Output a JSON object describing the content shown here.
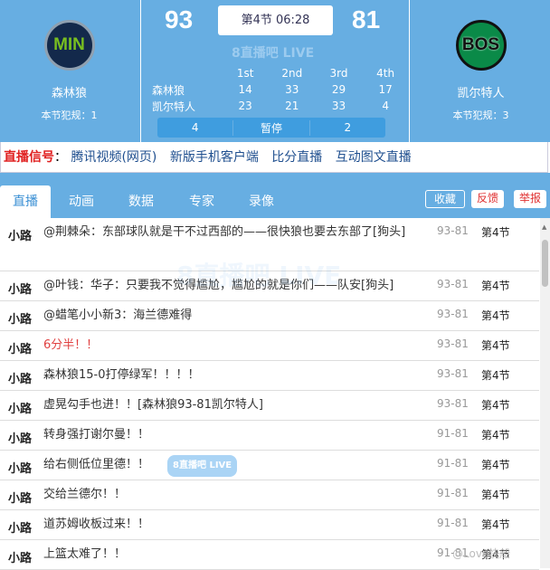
{
  "home": {
    "abbr": "MIN",
    "name": "森林狼",
    "fouls": "本节犯规：1",
    "score": "93",
    "timeouts": "4",
    "color": "#4bb53a"
  },
  "away": {
    "abbr": "BOS",
    "name": "凯尔特人",
    "fouls": "本节犯规：3",
    "score": "81",
    "timeouts": "2",
    "color": "#0a8a48"
  },
  "clock": "第4节 06:28",
  "watermark": "8直播吧 LIVE",
  "quarters": {
    "headers": [
      "1st",
      "2nd",
      "3rd",
      "4th"
    ],
    "rows": [
      {
        "team": "森林狼",
        "scores": [
          "14",
          "33",
          "29",
          "17"
        ]
      },
      {
        "team": "凯尔特人",
        "scores": [
          "23",
          "21",
          "33",
          "4"
        ]
      }
    ]
  },
  "timeout_label": "暂停",
  "signal": {
    "label": "直播信号",
    "colon": "：",
    "links": [
      "腾讯视频(网页)",
      "新版手机客户端",
      "比分直播",
      "互动图文直播"
    ]
  },
  "tabs": [
    "直播",
    "动画",
    "数据",
    "专家",
    "录像"
  ],
  "actions": [
    "收藏",
    "反馈",
    "举报"
  ],
  "feed": [
    {
      "who": "小路",
      "msg": "@荆棘朵：东部球队就是干不过西部的——很快狼也要去东部了[狗头]",
      "score": "93-81",
      "period": "第4节"
    },
    {
      "who": "小路",
      "msg": "@叶钱：华子：只要我不觉得尴尬，尴尬的就是你们——队安[狗头]",
      "score": "93-81",
      "period": "第4节"
    },
    {
      "who": "小路",
      "msg": "@蜡笔小小新3：海兰德难得",
      "score": "93-81",
      "period": "第4节"
    },
    {
      "who": "小路",
      "msg": "6分半！！",
      "score": "93-81",
      "period": "第4节"
    },
    {
      "who": "小路",
      "msg": "森林狼15-0打停绿军！！！！",
      "score": "93-81",
      "period": "第4节"
    },
    {
      "who": "小路",
      "msg": "虚晃勾手也进！！[森林狼93-81凯尔特人]",
      "score": "93-81",
      "period": "第4节"
    },
    {
      "who": "小路",
      "msg": "转身强打谢尔曼！！",
      "score": "91-81",
      "period": "第4节"
    },
    {
      "who": "小路",
      "msg": "给右侧低位里德！！",
      "score": "91-81",
      "period": "第4节"
    },
    {
      "who": "小路",
      "msg": "交给兰德尔！！",
      "score": "91-81",
      "period": "第4节"
    },
    {
      "who": "小路",
      "msg": "道苏姆收板过来！！",
      "score": "91-81",
      "period": "第4节"
    },
    {
      "who": "小路",
      "msg": "上篮太难了！！",
      "score": "91-81",
      "period": "第4节"
    }
  ],
  "corner_mark": "@Love快船"
}
